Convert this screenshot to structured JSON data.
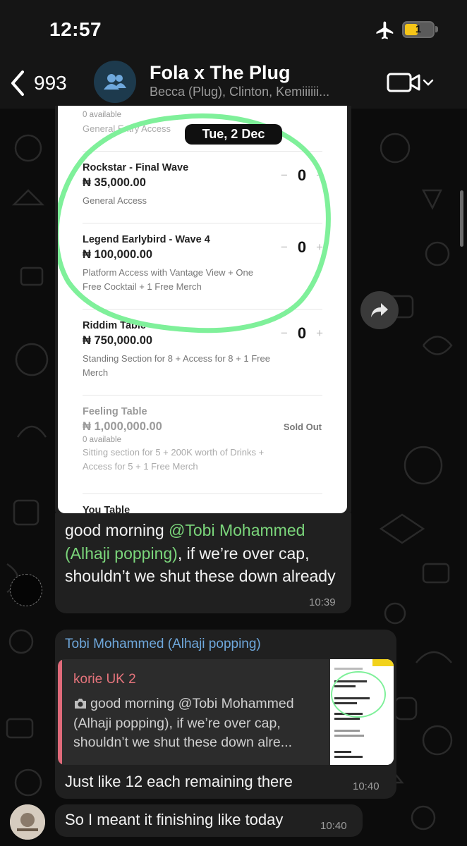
{
  "status_bar": {
    "time": "12:57",
    "battery": "1"
  },
  "header": {
    "back_count": "993",
    "title": "Fola x The Plug",
    "subtitle": "Becca (Plug), Clinton, Kemiiiiii..."
  },
  "date_chip": "Tue, 2 Dec",
  "screenshot": {
    "top_partial": {
      "avail": "0 available",
      "desc": "General Entry Access"
    },
    "tickets": [
      {
        "name": "Rockstar - Final Wave",
        "price": "₦ 35,000.00",
        "desc": "General Access",
        "qty": "0"
      },
      {
        "name": "Legend Earlybird - Wave 4",
        "price": "₦ 100,000.00",
        "desc": "Platform Access with Vantage View + One Free Cocktail + 1 Free Merch",
        "qty": "0"
      },
      {
        "name": "Riddim Table",
        "price": "₦ 750,000.00",
        "desc": "Standing Section for 8 + Access for 8 + 1 Free Merch",
        "qty": "0"
      },
      {
        "name": "Feeling Table",
        "price": "₦ 1,000,000.00",
        "avail": "0 available",
        "desc": "Sitting section for 5 + 200K worth of Drinks + Access for 5 + 1 Free Merch",
        "status": "Sold Out"
      },
      {
        "name": "You Table"
      }
    ],
    "stepper_minus": "−",
    "stepper_plus": "+"
  },
  "messages": [
    {
      "text_before": "good morning ",
      "mention": "@Tobi Mohammed (Alhaji popping)",
      "text_after": ", if we’re over cap, shouldn’t we shut these down already",
      "time": "10:39"
    },
    {
      "sender": "Tobi Mohammed (Alhaji popping)",
      "quote_author": "korie UK 2",
      "quote_text_before": "good morning ",
      "quote_mention": "@Tobi Mohammed (Alhaji popping)",
      "quote_text_after": ", if we’re over cap, shouldn’t we shut these down alre...",
      "text": "Just like 12 each remaining there",
      "time": "10:40"
    },
    {
      "text": "So I meant it finishing like today",
      "time": "10:40"
    }
  ],
  "colors": {
    "mention_green": "#7bd67b",
    "sender_blue": "#6fa8dc",
    "quote_red": "#e06a7a",
    "circle_green": "#7ff09a"
  }
}
